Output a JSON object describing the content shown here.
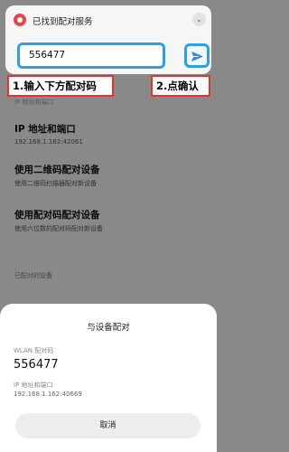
{
  "notification": {
    "title": "已找到配对服务",
    "code_input": "556477"
  },
  "annotations": {
    "step1": "1.输入下方配对码",
    "step2": "2.点确认"
  },
  "settings": {
    "partial_text": "IP 地址和端口",
    "ip_row": {
      "title": "IP 地址和端口",
      "subtitle": "192.168.1.162:42061"
    },
    "qr_row": {
      "title": "使用二维码配对设备",
      "subtitle": "使用二维码扫描器配对新设备"
    },
    "code_row": {
      "title": "使用配对码配对设备",
      "subtitle": "使用六位数的配对码配对新设备"
    },
    "paired_label": "已配对的设备"
  },
  "dialog": {
    "title": "与设备配对",
    "code_label": "WLAN 配对码",
    "code": "556477",
    "ip_label": "IP 地址和端口",
    "ip": "192.168.1.162:40669",
    "cancel": "取消"
  },
  "colors": {
    "highlight": "#2aa0e8",
    "annotation": "#e1352c",
    "app_icon": "#e8444a"
  }
}
